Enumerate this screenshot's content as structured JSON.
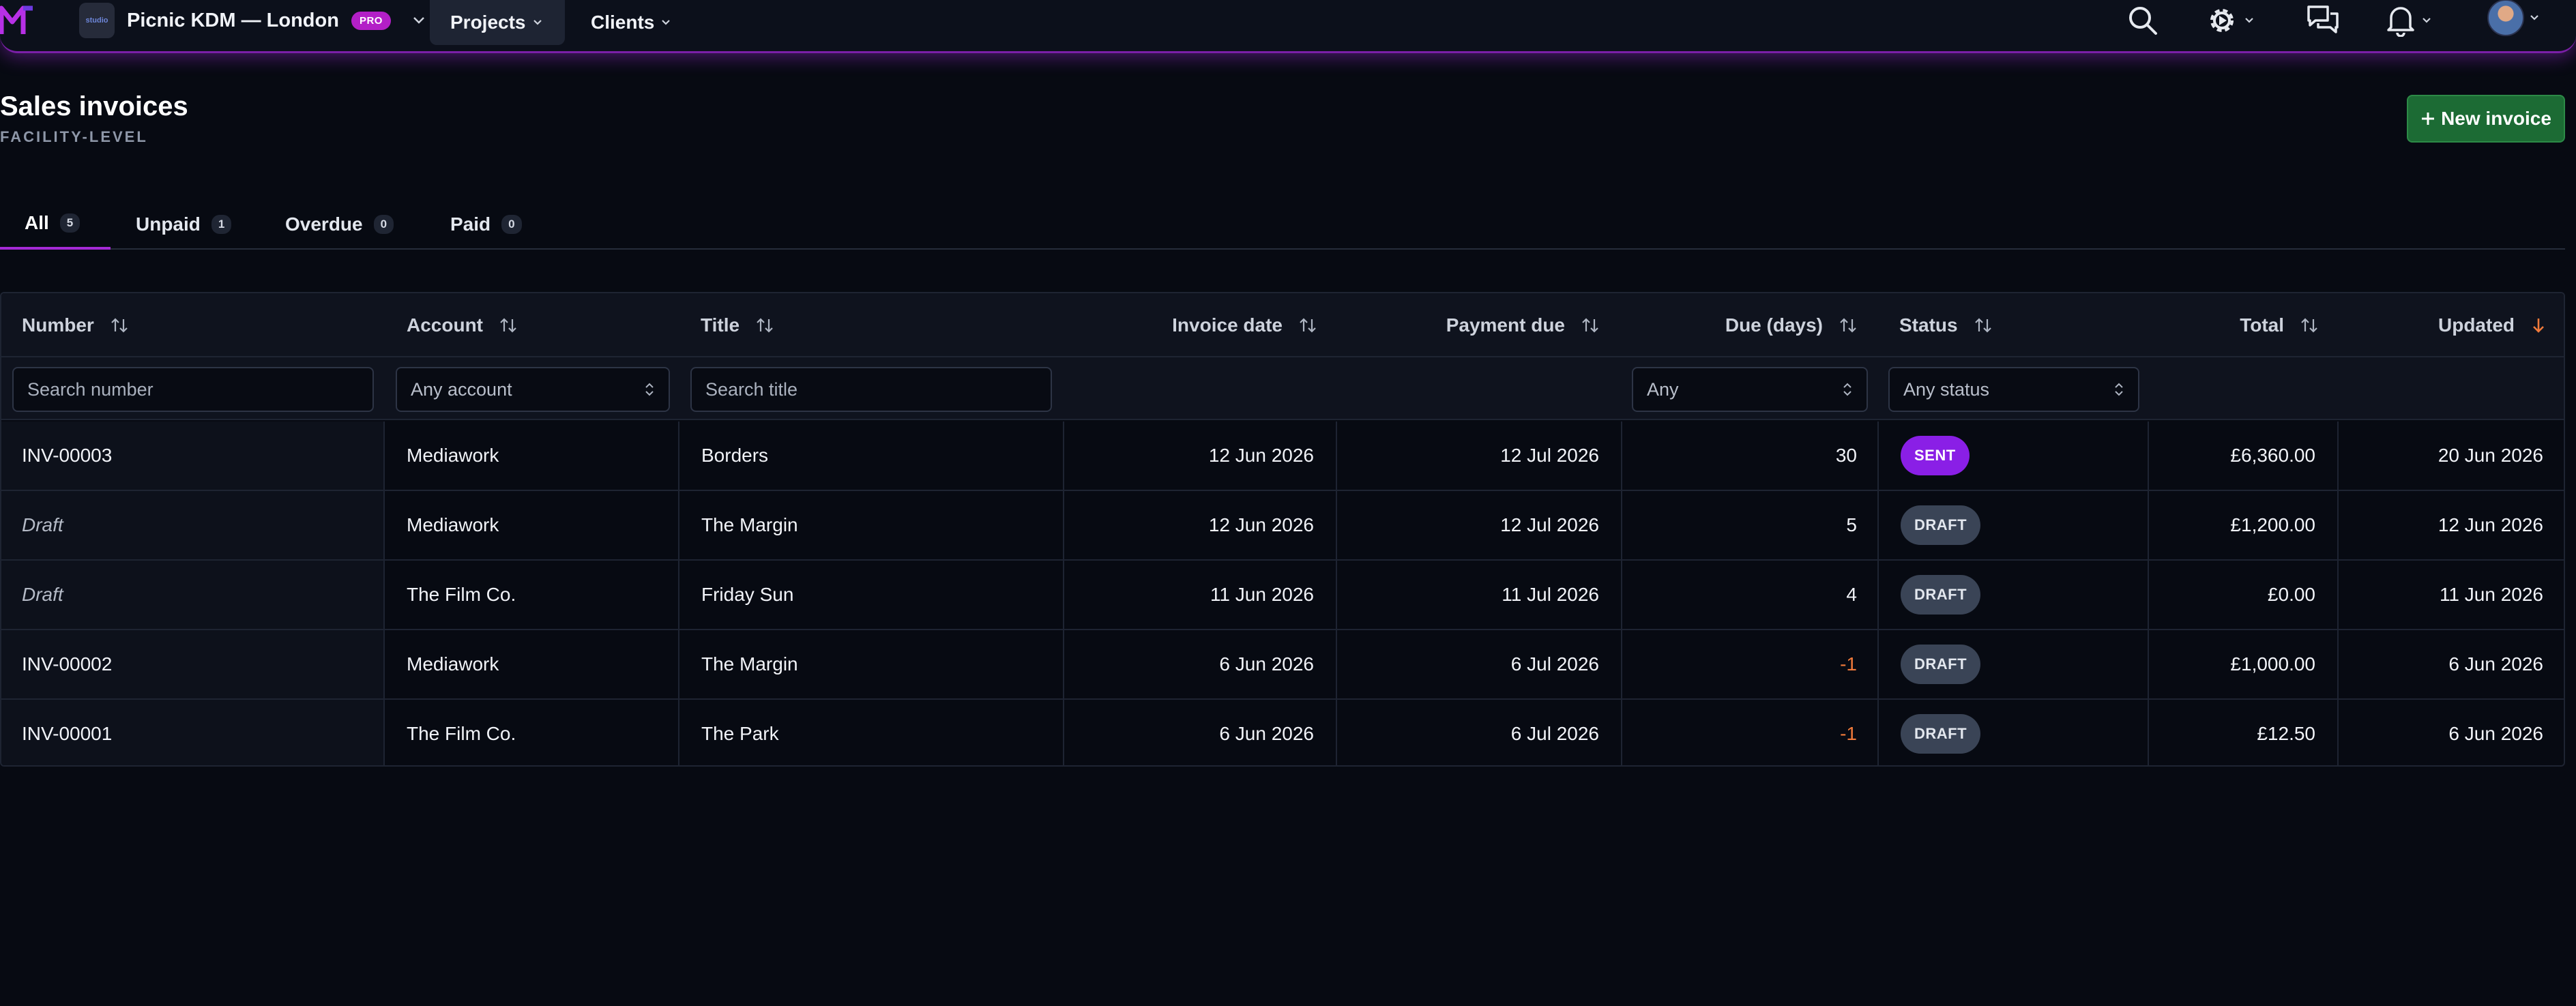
{
  "topbar": {
    "org_name": "Picnic KDM — London",
    "org_avatar_text": "studio",
    "pro_badge": "PRO",
    "nav": {
      "projects": "Projects",
      "clients": "Clients"
    }
  },
  "header": {
    "title": "Sales invoices",
    "subtitle": "FACILITY-LEVEL",
    "new_button": "New invoice"
  },
  "tabs": [
    {
      "label": "All",
      "count": "5"
    },
    {
      "label": "Unpaid",
      "count": "1"
    },
    {
      "label": "Overdue",
      "count": "0"
    },
    {
      "label": "Paid",
      "count": "0"
    }
  ],
  "table": {
    "columns": {
      "number": "Number",
      "account": "Account",
      "title": "Title",
      "invoice_date": "Invoice date",
      "payment_due": "Payment due",
      "due_days": "Due (days)",
      "status": "Status",
      "total": "Total",
      "updated": "Updated"
    },
    "filters": {
      "number_placeholder": "Search number",
      "account": "Any account",
      "title_placeholder": "Search title",
      "due": "Any",
      "status": "Any status"
    },
    "rows": [
      {
        "number": "INV-00003",
        "account": "Mediawork",
        "title": "Borders",
        "invoice_date": "12 Jun 2026",
        "payment_due": "12 Jul 2026",
        "due_days": "30",
        "status": "SENT",
        "total": "£6,360.00",
        "updated": "20 Jun 2026"
      },
      {
        "number": "Draft",
        "account": "Mediawork",
        "title": "The Margin",
        "invoice_date": "12 Jun 2026",
        "payment_due": "12 Jul 2026",
        "due_days": "5",
        "status": "DRAFT",
        "total": "£1,200.00",
        "updated": "12 Jun 2026"
      },
      {
        "number": "Draft",
        "account": "The Film Co.",
        "title": "Friday Sun",
        "invoice_date": "11 Jun 2026",
        "payment_due": "11 Jul 2026",
        "due_days": "4",
        "status": "DRAFT",
        "total": "£0.00",
        "updated": "11 Jun 2026"
      },
      {
        "number": "INV-00002",
        "account": "Mediawork",
        "title": "The Margin",
        "invoice_date": "6 Jun 2026",
        "payment_due": "6 Jul 2026",
        "due_days": "-1",
        "status": "DRAFT",
        "total": "£1,000.00",
        "updated": "6 Jun 2026"
      },
      {
        "number": "INV-00001",
        "account": "The Film Co.",
        "title": "The Park",
        "invoice_date": "6 Jun 2026",
        "payment_due": "6 Jul 2026",
        "due_days": "-1",
        "status": "DRAFT",
        "total": "£12.50",
        "updated": "6 Jun 2026"
      }
    ]
  },
  "colors": {
    "accent": "#a52ad6",
    "sent": "#8a1fe6",
    "draft": "#3a4456",
    "primary_button": "#1c6b34",
    "negative": "#f07a3b",
    "sort_active": "#f07a3b"
  },
  "icons": [
    "app-logo-icon",
    "chevron-down-icon",
    "search-icon",
    "gear-icon",
    "chat-icon",
    "bell-icon",
    "sort-icon",
    "sort-desc-icon",
    "select-arrows-icon",
    "plus-icon"
  ]
}
